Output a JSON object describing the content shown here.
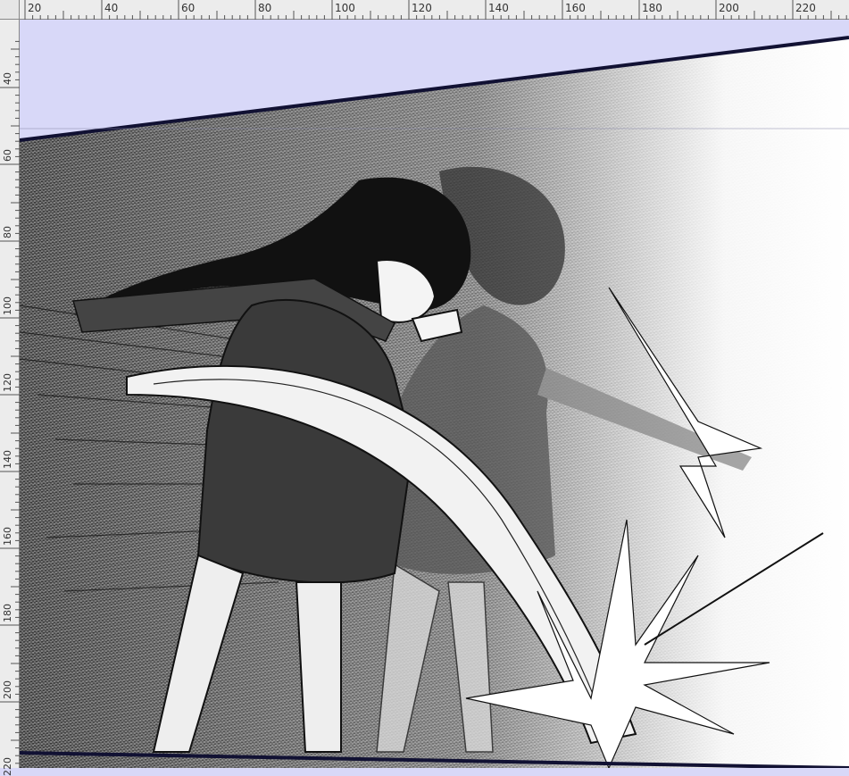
{
  "ruler": {
    "unit_step": 20,
    "horizontal_labels": [
      "20",
      "40",
      "60",
      "80",
      "100",
      "120",
      "140",
      "160",
      "180",
      "200",
      "220"
    ],
    "vertical_labels": [
      "40",
      "60",
      "80",
      "100",
      "120",
      "140",
      "160",
      "180",
      "200",
      "220"
    ]
  },
  "colors": {
    "ruler_bg": "#ececec",
    "pasteboard": "#d8d8f8",
    "panel_border": "#111133",
    "ink": "#111111",
    "accent": "#6a8fd0"
  },
  "artwork": {
    "subject": "manga-panel-two-figures-punch",
    "style": "black-and-white-screentone"
  }
}
